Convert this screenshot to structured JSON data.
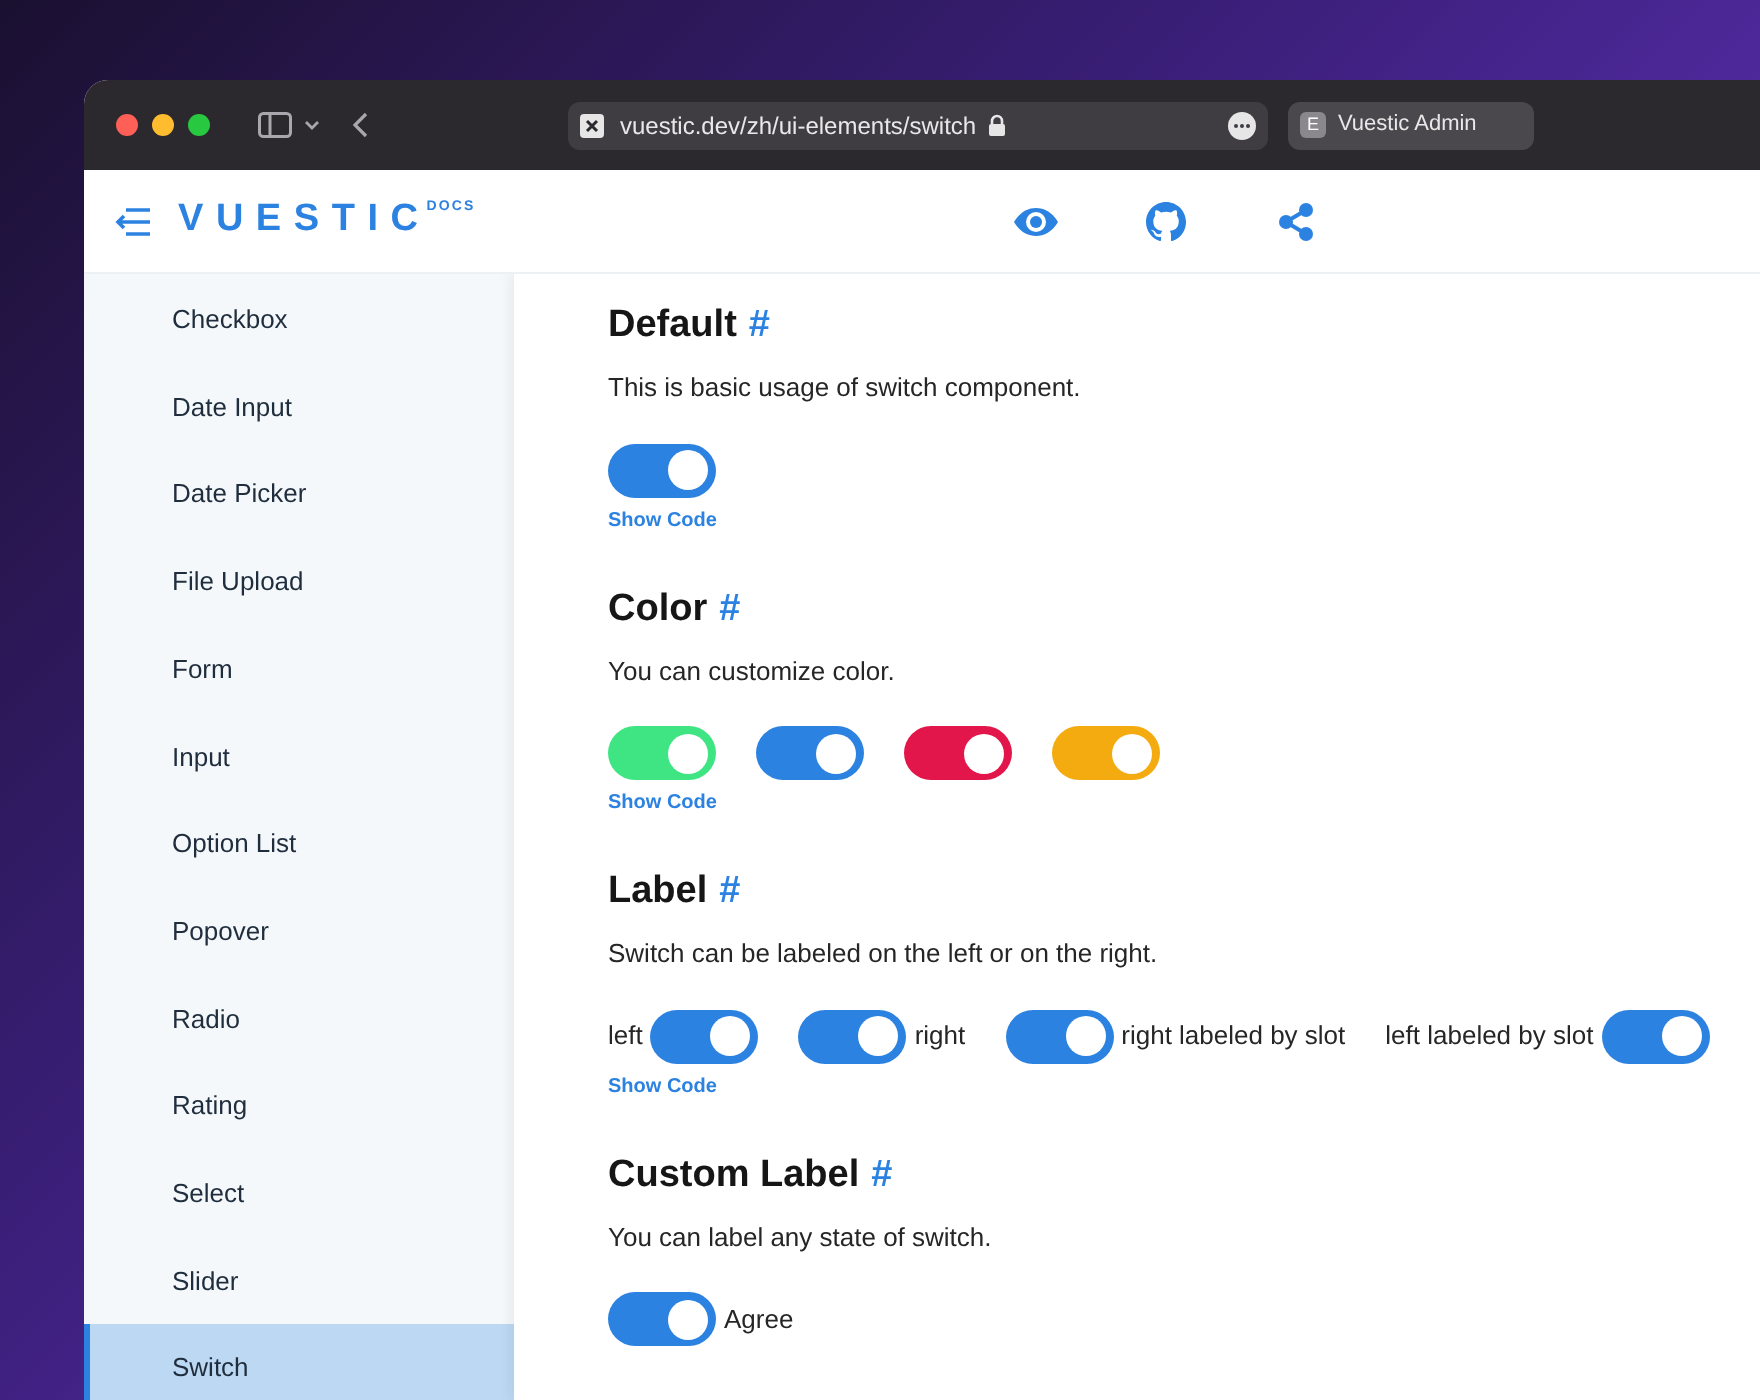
{
  "browser": {
    "url": "vuestic.dev/zh/ui-elements/switch",
    "tab_icon": "E",
    "tab": "Vuestic Admin"
  },
  "header": {
    "logo": "VUESTIC",
    "logo_badge": "DOCS"
  },
  "sidebar": {
    "items": [
      {
        "label": "Checkbox",
        "selected": false
      },
      {
        "label": "Date Input",
        "selected": false
      },
      {
        "label": "Date Picker",
        "selected": false
      },
      {
        "label": "File Upload",
        "selected": false
      },
      {
        "label": "Form",
        "selected": false
      },
      {
        "label": "Input",
        "selected": false
      },
      {
        "label": "Option List",
        "selected": false
      },
      {
        "label": "Popover",
        "selected": false
      },
      {
        "label": "Radio",
        "selected": false
      },
      {
        "label": "Rating",
        "selected": false
      },
      {
        "label": "Select",
        "selected": false
      },
      {
        "label": "Slider",
        "selected": false
      },
      {
        "label": "Switch",
        "selected": true
      }
    ]
  },
  "sections": [
    {
      "title": "Default",
      "anchor": "#",
      "description": "This is basic usage of switch component.",
      "switches": [
        {
          "checked": true,
          "color": "#2c82e0"
        }
      ],
      "show_code": "Show Code"
    },
    {
      "title": "Color",
      "anchor": "#",
      "description": "You can customize color.",
      "switches": [
        {
          "checked": true,
          "color": "#40e583"
        },
        {
          "checked": true,
          "color": "#2c82e0"
        },
        {
          "checked": true,
          "color": "#e2164a"
        },
        {
          "checked": true,
          "color": "#f4ab0f"
        }
      ],
      "show_code": "Show Code"
    },
    {
      "title": "Label",
      "anchor": "#",
      "description": "Switch can be labeled on the left or on the right.",
      "switches": [
        {
          "kind": "label-left",
          "checked": true,
          "color": "#2c82e0",
          "label": "left"
        },
        {
          "kind": "label-right",
          "checked": true,
          "color": "#2c82e0",
          "label": "right"
        },
        {
          "kind": "label-right",
          "checked": true,
          "color": "#2c82e0",
          "label": "right labeled by slot"
        },
        {
          "kind": "label-left",
          "checked": true,
          "color": "#2c82e0",
          "label": "left labeled by slot"
        }
      ],
      "show_code": "Show Code"
    },
    {
      "title": "Custom Label",
      "anchor": "#",
      "description": "You can label any state of switch.",
      "switches": [
        {
          "kind": "label-right",
          "checked": true,
          "color": "#2c82e0",
          "label": "Agree"
        }
      ]
    }
  ]
}
